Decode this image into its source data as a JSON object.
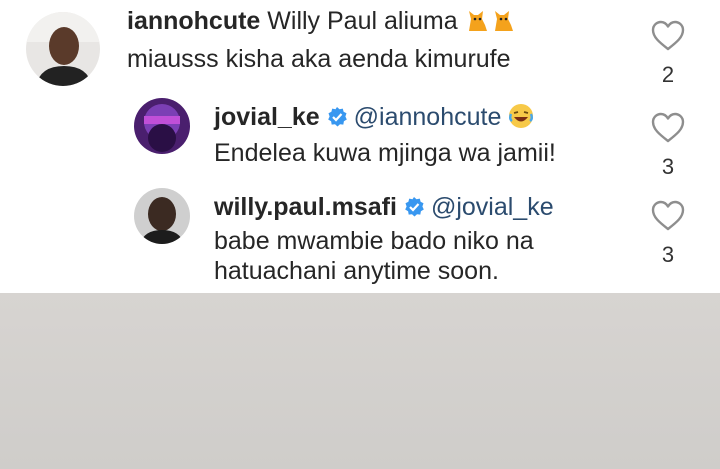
{
  "comments": [
    {
      "username": "iannohcute",
      "line1": "Willy Paul aliuma",
      "line2": "miausss kisha aka aenda kimurufe",
      "emoji": [
        "cat-emoji",
        "cat-emoji"
      ],
      "likes": "2",
      "verified": false
    },
    {
      "username": "jovial_ke",
      "mention": "@iannohcute",
      "line2": "Endelea kuwa mjinga wa jamii!",
      "emoji": [
        "laughing-emoji"
      ],
      "likes": "3",
      "verified": true
    },
    {
      "username": "willy.paul.msafi",
      "mention": "@jovial_ke",
      "line2": "babe mwambie bado niko na",
      "line3": "hatuachani anytime soon.",
      "likes": "3",
      "verified": true
    }
  ],
  "colors": {
    "verified_badge": "#3897f0",
    "mention": "#2b4b6e",
    "bottom_panel": "#d3d1ce"
  }
}
